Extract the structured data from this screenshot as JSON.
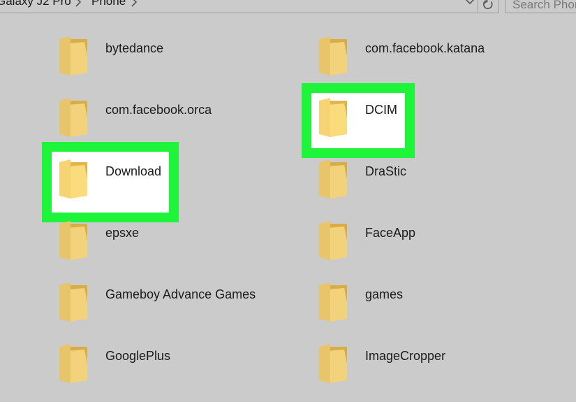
{
  "breadcrumb": {
    "device": "Galaxy J2 Pro",
    "location": "Phone"
  },
  "search": {
    "placeholder": "Search Phone"
  },
  "colors": {
    "highlight": "#1ef53a",
    "background": "#cbcbcb",
    "folder": "#e8c46a"
  },
  "folders": [
    {
      "name": "bytedance",
      "highlighted": false
    },
    {
      "name": "com.facebook.katana",
      "highlighted": false
    },
    {
      "name": "com.facebook.orca",
      "highlighted": false
    },
    {
      "name": "DCIM",
      "highlighted": true
    },
    {
      "name": "Download",
      "highlighted": true
    },
    {
      "name": "DraStic",
      "highlighted": false
    },
    {
      "name": "epsxe",
      "highlighted": false
    },
    {
      "name": "FaceApp",
      "highlighted": false
    },
    {
      "name": "Gameboy Advance Games",
      "highlighted": false
    },
    {
      "name": "games",
      "highlighted": false
    },
    {
      "name": "GooglePlus",
      "highlighted": false
    },
    {
      "name": "ImageCropper",
      "highlighted": false
    }
  ]
}
